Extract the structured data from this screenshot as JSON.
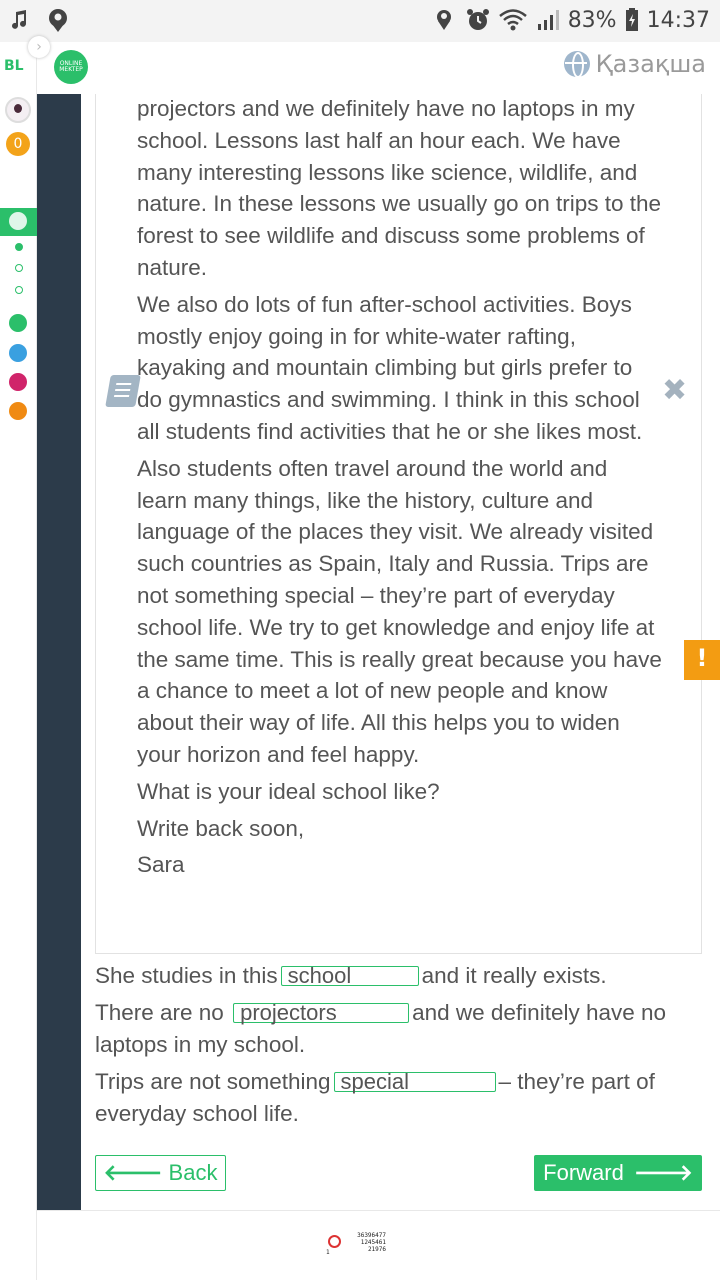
{
  "status_bar": {
    "battery": "83%",
    "time": "14:37",
    "icons": [
      "music-icon",
      "location-icon",
      "location-icon",
      "alarm-icon",
      "wifi-icon",
      "signal-icon",
      "battery-icon"
    ]
  },
  "sidebar": {
    "logo": "BL",
    "coins": "0"
  },
  "header": {
    "brand": "ONLINE MEKTEP",
    "language": "Қазақша"
  },
  "reading": {
    "paragraphs": [
      "projectors and we definitely have no laptops in my school. Lessons last half an hour each. We have many interesting lessons like science, wildlife, and nature. In these lessons we usually go on trips to the forest to see wildlife and discuss some problems of nature.",
      "We also do lots of fun after-school activities. Boys mostly enjoy going in for white-water rafting, kayaking and mountain climbing but girls prefer to do gymnastics and swimming. I think in this school all students find activities that he or she likes most.",
      "Also students often travel around the world and learn many things, like the history, culture and language of the places they visit. We already visited such countries as Spain, Italy and Russia. Trips are not something special – they’re part of everyday school life. We try to get knowledge and enjoy life at the same time. This is really great because you have a chance to meet a lot of new people and know about their way of life. All this helps you to widen your horizon and feel happy.",
      "What is your ideal school like?",
      "Write back soon,",
      "Sara"
    ]
  },
  "questions": [
    {
      "before": "She studies in this",
      "answer": "school",
      "after": "and it really exists."
    },
    {
      "before": "There are no",
      "answer": "projectors",
      "after": "and we definitely have no laptops in my school."
    },
    {
      "before": "Trips are not something",
      "answer": "special",
      "after": "– they’re part of everyday school life."
    }
  ],
  "nav": {
    "back_label": "Back",
    "forward_label": "Forward"
  },
  "footer_counter": {
    "line1": "36396477",
    "line2": "1245461",
    "line3": "21976",
    "line0": "1"
  }
}
